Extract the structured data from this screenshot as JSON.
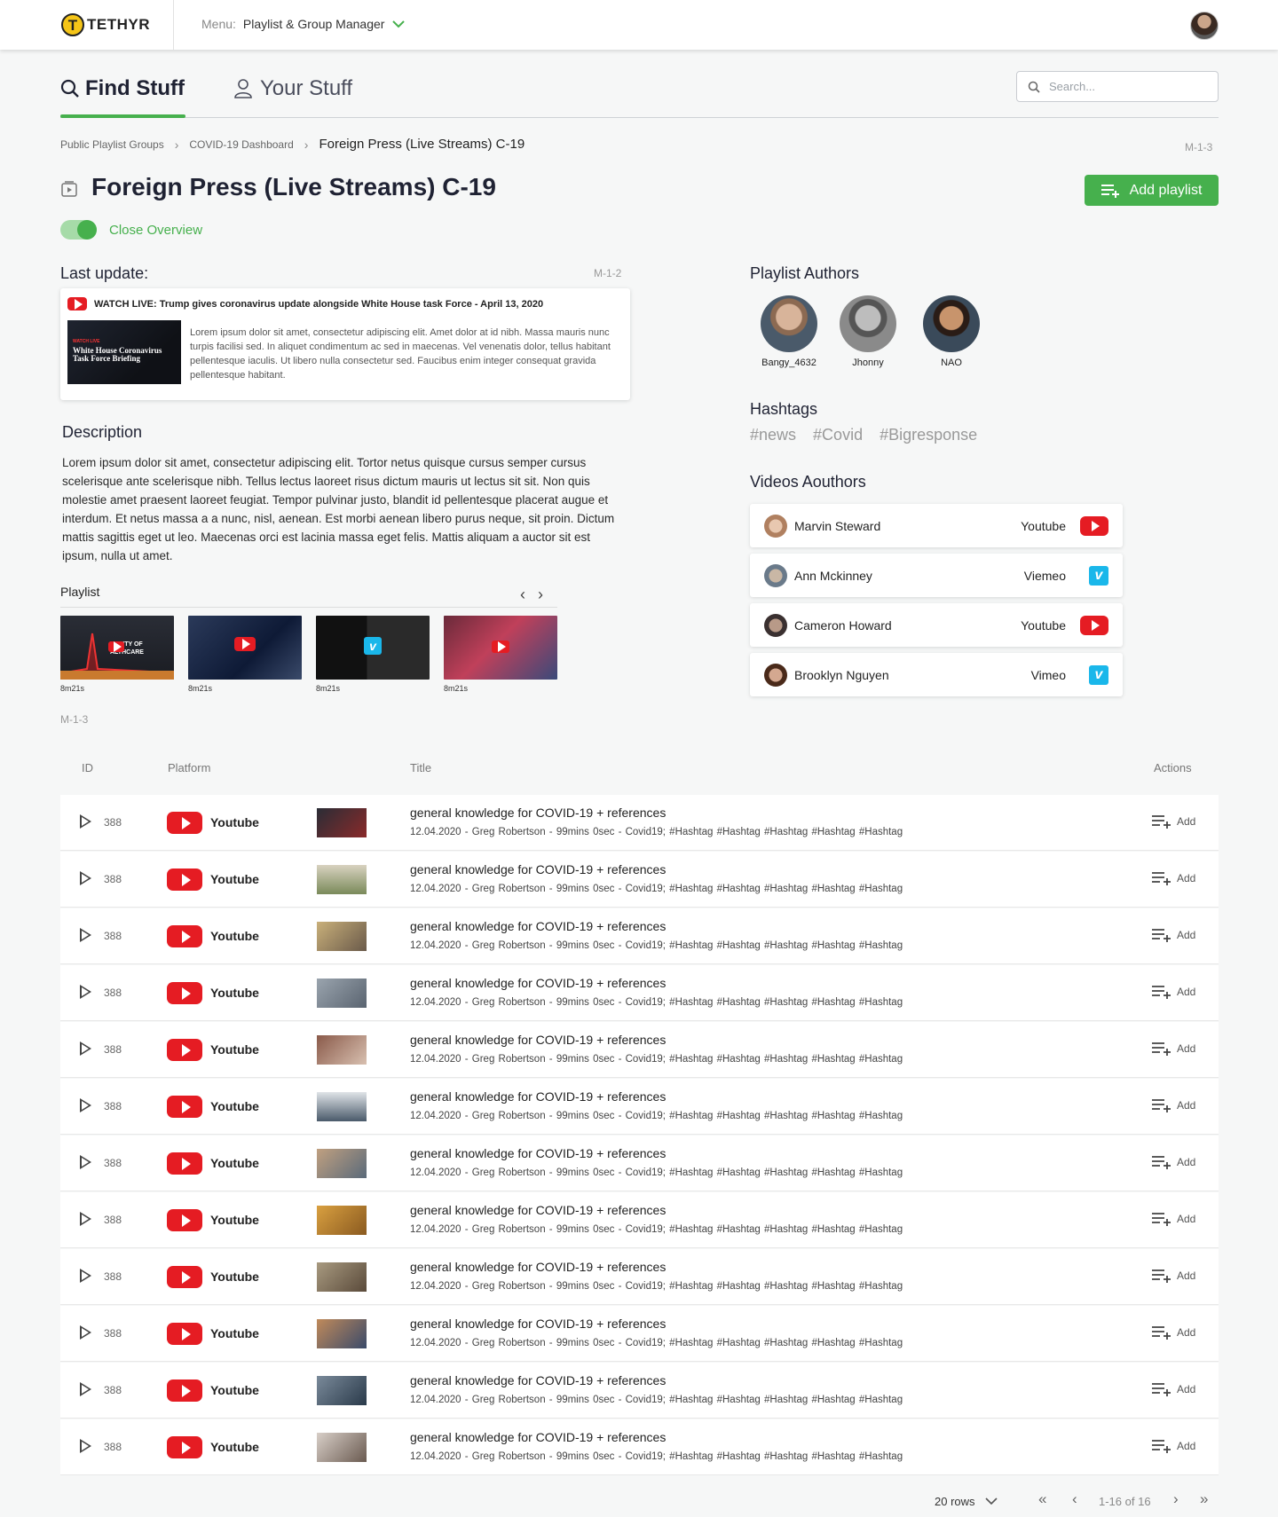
{
  "header": {
    "brand": "TETHYR",
    "menu_label": "Menu:",
    "menu_value": "Playlist & Group Manager"
  },
  "tabs": [
    {
      "label": "Find Stuff",
      "active": true
    },
    {
      "label": "Your Stuff",
      "active": false
    }
  ],
  "search": {
    "placeholder": "Search..."
  },
  "breadcrumb": {
    "items": [
      "Public Playlist Groups",
      "COVID-19 Dashboard",
      "Foreign Press (Live Streams) C-19"
    ],
    "code": "M-1-3"
  },
  "page": {
    "title": "Foreign Press (Live Streams) C-19",
    "add_playlist": "Add playlist",
    "toggle_label": "Close Overview",
    "toggle_on": true
  },
  "last_update": {
    "heading": "Last update:",
    "code": "M-1-2",
    "headline": "WATCH LIVE: Trump gives coronavirus update alongside White House task Force  - April 13, 2020",
    "thumb_live": "WATCH LIVE",
    "thumb_caption": "White House Coronavirus Task Force Briefing",
    "text": "Lorem ipsum dolor sit amet, consectetur adipiscing elit. Amet dolor at id nibh. Massa mauris nunc turpis facilisi sed. In aliquet condimentum ac sed in maecenas. Vel venenatis dolor, tellus habitant pellentesque iaculis. Ut libero nulla consectetur sed. Faucibus enim integer consequat gravida pellentesque habitant."
  },
  "description": {
    "heading": "Description",
    "text": "Lorem ipsum dolor sit amet, consectetur adipiscing elit. Tortor netus quisque cursus semper cursus scelerisque ante scelerisque nibh. Tellus lectus laoreet risus dictum mauris ut lectus sit sit. Non quis molestie amet praesent laoreet feugiat. Tempor pulvinar justo, blandit id pellentesque placerat augue et interdum. Et netus massa a a nunc, nisl, aenean. Est morbi aenean libero purus neque, sit proin. Dictum mattis sagittis eget ut leo. Maecenas orci est lacinia massa eget felis. Mattis aliquam a auctor sit est ipsum, nulla ut amet."
  },
  "playlist": {
    "heading": "Playlist",
    "code": "M-1-3",
    "thumb_text": "PACITY OF\nALTHCARE",
    "items": [
      {
        "duration": "8m21s"
      },
      {
        "duration": "8m21s"
      },
      {
        "duration": "8m21s"
      },
      {
        "duration": "8m21s"
      }
    ]
  },
  "playlist_authors": {
    "heading": "Playlist Authors",
    "items": [
      {
        "name": "Bangy_4632"
      },
      {
        "name": "Jhonny"
      },
      {
        "name": "NAO"
      }
    ]
  },
  "hashtags": {
    "heading": "Hashtags",
    "items": [
      "#news",
      "#Covid",
      "#Bigresponse"
    ]
  },
  "video_authors": {
    "heading": "Videos Aouthors",
    "items": [
      {
        "name": "Marvin Steward",
        "platform": "Youtube",
        "icon": "youtube-icon"
      },
      {
        "name": "Ann Mckinney",
        "platform": "Viemeo",
        "icon": "vimeo-icon"
      },
      {
        "name": "Cameron Howard",
        "platform": "Youtube",
        "icon": "youtube-icon"
      },
      {
        "name": "Brooklyn Nguyen",
        "platform": "Vimeo",
        "icon": "vimeo-icon"
      }
    ]
  },
  "table": {
    "columns": [
      "ID",
      "Platform",
      "Title",
      "Actions"
    ],
    "rows": [
      {
        "id": "388",
        "platform": "Youtube",
        "title": "general knowledge for COVID-19 + references",
        "meta": "12.04.2020 - Greg Robertson - 99mins 0sec - Covid19; #Hashtag  #Hashtag  #Hashtag  #Hashtag  #Hashtag",
        "action": "Add"
      },
      {
        "id": "388",
        "platform": "Youtube",
        "title": "general knowledge for COVID-19 + references",
        "meta": "12.04.2020 - Greg Robertson - 99mins 0sec - Covid19; #Hashtag  #Hashtag  #Hashtag  #Hashtag  #Hashtag",
        "action": "Add"
      },
      {
        "id": "388",
        "platform": "Youtube",
        "title": "general knowledge for COVID-19 + references",
        "meta": "12.04.2020 - Greg Robertson - 99mins 0sec - Covid19; #Hashtag  #Hashtag  #Hashtag  #Hashtag  #Hashtag",
        "action": "Add"
      },
      {
        "id": "388",
        "platform": "Youtube",
        "title": "general knowledge for COVID-19 + references",
        "meta": "12.04.2020 - Greg Robertson - 99mins 0sec - Covid19; #Hashtag  #Hashtag  #Hashtag  #Hashtag  #Hashtag",
        "action": "Add"
      },
      {
        "id": "388",
        "platform": "Youtube",
        "title": "general knowledge for COVID-19 + references",
        "meta": "12.04.2020 - Greg Robertson - 99mins 0sec - Covid19; #Hashtag  #Hashtag  #Hashtag  #Hashtag  #Hashtag",
        "action": "Add"
      },
      {
        "id": "388",
        "platform": "Youtube",
        "title": "general knowledge for COVID-19 + references",
        "meta": "12.04.2020 - Greg Robertson - 99mins 0sec - Covid19; #Hashtag  #Hashtag  #Hashtag  #Hashtag  #Hashtag",
        "action": "Add"
      },
      {
        "id": "388",
        "platform": "Youtube",
        "title": "general knowledge for COVID-19 + references",
        "meta": "12.04.2020 - Greg Robertson - 99mins 0sec - Covid19; #Hashtag  #Hashtag  #Hashtag  #Hashtag  #Hashtag",
        "action": "Add"
      },
      {
        "id": "388",
        "platform": "Youtube",
        "title": "general knowledge for COVID-19 + references",
        "meta": "12.04.2020 - Greg Robertson - 99mins 0sec - Covid19; #Hashtag  #Hashtag  #Hashtag  #Hashtag  #Hashtag",
        "action": "Add"
      },
      {
        "id": "388",
        "platform": "Youtube",
        "title": "general knowledge for COVID-19 + references",
        "meta": "12.04.2020 - Greg Robertson - 99mins 0sec - Covid19; #Hashtag  #Hashtag  #Hashtag  #Hashtag  #Hashtag",
        "action": "Add"
      },
      {
        "id": "388",
        "platform": "Youtube",
        "title": "general knowledge for COVID-19 + references",
        "meta": "12.04.2020 - Greg Robertson - 99mins 0sec - Covid19; #Hashtag  #Hashtag  #Hashtag  #Hashtag  #Hashtag",
        "action": "Add"
      },
      {
        "id": "388",
        "platform": "Youtube",
        "title": "general knowledge for COVID-19 + references",
        "meta": "12.04.2020 - Greg Robertson - 99mins 0sec - Covid19; #Hashtag  #Hashtag  #Hashtag  #Hashtag  #Hashtag",
        "action": "Add"
      },
      {
        "id": "388",
        "platform": "Youtube",
        "title": "general knowledge for COVID-19 + references",
        "meta": "12.04.2020 - Greg Robertson - 99mins 0sec - Covid19; #Hashtag  #Hashtag  #Hashtag  #Hashtag  #Hashtag",
        "action": "Add"
      }
    ]
  },
  "pagination": {
    "rows_label": "20 rows",
    "range": "1-16 of 16"
  },
  "colors": {
    "accent": "#46b04d",
    "youtube": "#e51c23",
    "vimeo": "#1ab7ea"
  }
}
